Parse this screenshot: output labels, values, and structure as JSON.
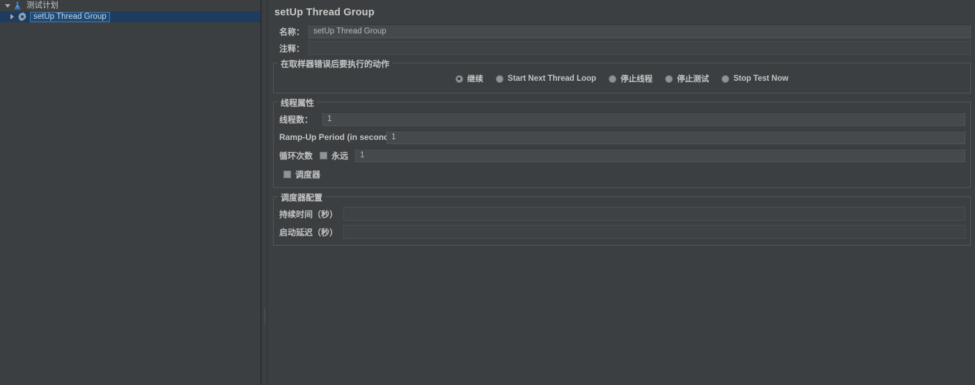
{
  "tree": {
    "items": [
      {
        "label": "测试计划",
        "icon": "test-plan-icon",
        "expanded": true,
        "selected": false
      },
      {
        "label": "setUp Thread Group",
        "icon": "gear-icon",
        "expanded": false,
        "selected": true
      }
    ]
  },
  "panel": {
    "title": "setUp Thread Group",
    "name_label": "名称：",
    "name_value": "setUp Thread Group",
    "comments_label": "注释：",
    "comments_value": ""
  },
  "error_action": {
    "group_title": "在取样器错误后要执行的动作",
    "options": [
      {
        "label": "继续",
        "selected": true
      },
      {
        "label": "Start Next Thread Loop",
        "selected": false
      },
      {
        "label": "停止线程",
        "selected": false
      },
      {
        "label": "停止测试",
        "selected": false
      },
      {
        "label": "Stop Test Now",
        "selected": false
      }
    ]
  },
  "thread_properties": {
    "group_title": "线程属性",
    "threads_label": "线程数：",
    "threads_value": "1",
    "rampup_label": "Ramp-Up Period (in seconds):",
    "rampup_value": "1",
    "loop_label": "循环次数",
    "forever_label": "永远",
    "forever_checked": false,
    "loop_value": "1",
    "scheduler_label": "调度器",
    "scheduler_checked": false
  },
  "scheduler_config": {
    "group_title": "调度器配置",
    "duration_label": "持续时间（秒）",
    "duration_value": "",
    "startup_delay_label": "启动延迟（秒）",
    "startup_delay_value": ""
  },
  "colors": {
    "window_bg": "#3c3f41",
    "field_bg": "#45494c",
    "selection_bg": "#1b4b78",
    "selection_row_bg": "#1d3c5f",
    "text": "#c4c4c4",
    "border": "#53575b"
  }
}
